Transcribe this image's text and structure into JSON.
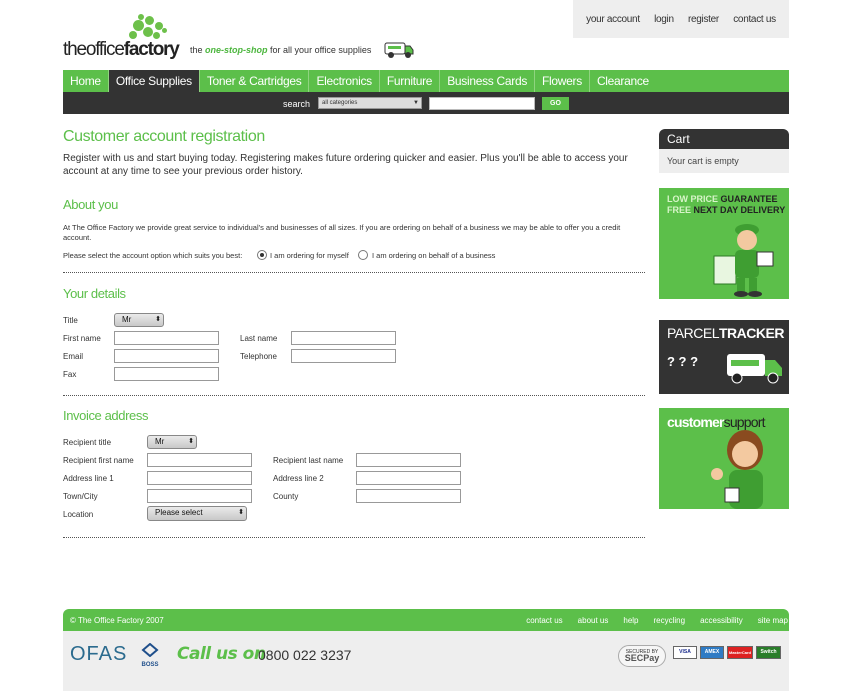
{
  "topnav": [
    "your account",
    "login",
    "register",
    "contact us"
  ],
  "logo": {
    "light": "the",
    "mid": "office",
    "bold": "factory"
  },
  "tagline": {
    "pre": "the",
    "highlight": "one-stop-shop",
    "post": "for all your office supplies"
  },
  "mainnav": [
    {
      "label": "Home",
      "active": false
    },
    {
      "label": "Office Supplies",
      "active": true
    },
    {
      "label": "Toner & Cartridges",
      "active": false
    },
    {
      "label": "Electronics",
      "active": false
    },
    {
      "label": "Furniture",
      "active": false
    },
    {
      "label": "Business Cards",
      "active": false
    },
    {
      "label": "Flowers",
      "active": false
    },
    {
      "label": "Clearance",
      "active": false
    }
  ],
  "search": {
    "label": "search",
    "category": "all categories",
    "button": "GO"
  },
  "page": {
    "title": "Customer account registration",
    "intro": "Register with us and start buying today. Registering makes future ordering quicker and easier. Plus you'll be able to access your account at any time to see your previous order history."
  },
  "about": {
    "heading": "About you",
    "text": "At The Office Factory we provide great service to individual's and businesses of all sizes. If you are ordering on behalf of a business we may be able to offer you a credit account.",
    "question": "Please select the account option which suits you best:",
    "option1": "I am ordering for myself",
    "option2": "I am ordering on behalf of a business",
    "selected": "option1"
  },
  "details": {
    "heading": "Your details",
    "title_label": "Title",
    "title_value": "Mr",
    "first_name": "First name",
    "last_name": "Last name",
    "email": "Email",
    "telephone": "Telephone",
    "fax": "Fax"
  },
  "invoice": {
    "heading": "Invoice address",
    "recipient_title": "Recipient title",
    "recipient_title_value": "Mr",
    "recipient_first": "Recipient first name",
    "recipient_last": "Recipient last name",
    "address1": "Address line 1",
    "address2": "Address line 2",
    "town": "Town/City",
    "county": "County",
    "location": "Location",
    "location_value": "Please select"
  },
  "cart": {
    "heading": "Cart",
    "status": "Your cart is empty"
  },
  "promos": {
    "guarantee_line1_a": "LOW PRICE",
    "guarantee_line1_b": "GUARANTEE",
    "guarantee_line2_a": "FREE",
    "guarantee_line2_b": "NEXT DAY DELIVERY",
    "tracker_a": "PARCEL",
    "tracker_b": "TRACKER",
    "support_a": "customer",
    "support_b": "support"
  },
  "footer": {
    "copyright": "© The Office Factory 2007",
    "links": [
      "contact us",
      "about us",
      "help",
      "recycling",
      "accessibility",
      "site map"
    ],
    "ofas": "OFAS",
    "boss": "BOSS",
    "call": "Call us on",
    "phone": "0800 022 3237",
    "secpay_top": "SECURED BY",
    "secpay": "SECPay",
    "cards": [
      "VISA",
      "AMEX",
      "MasterCard",
      "Switch"
    ]
  },
  "colors": {
    "brand_green": "#5cbf4a",
    "dark": "#333333"
  }
}
